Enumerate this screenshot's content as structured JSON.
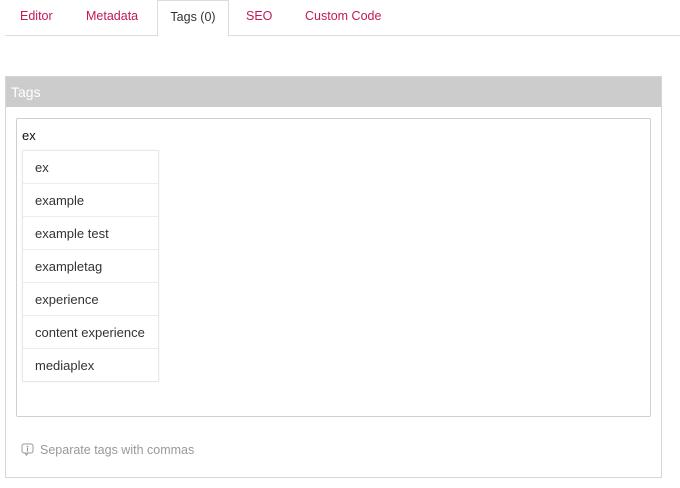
{
  "tabs": [
    {
      "label": "Editor",
      "active": false
    },
    {
      "label": "Metadata",
      "active": false
    },
    {
      "label": "Tags (0)",
      "active": true
    },
    {
      "label": "SEO",
      "active": false
    },
    {
      "label": "Custom Code",
      "active": false
    }
  ],
  "tags_panel": {
    "title": "Tags",
    "input_value": "ex",
    "suggestions": [
      "ex",
      "example",
      "example test",
      "exampletag",
      "experience",
      "content experience",
      "mediaplex"
    ],
    "hint": "Separate tags with commas",
    "hint_icon": "info-icon"
  },
  "colors": {
    "tab_link": "#c2185b",
    "panel_header_bg": "#cccccc",
    "panel_header_text": "#ffffff",
    "hint_text": "#999999"
  }
}
